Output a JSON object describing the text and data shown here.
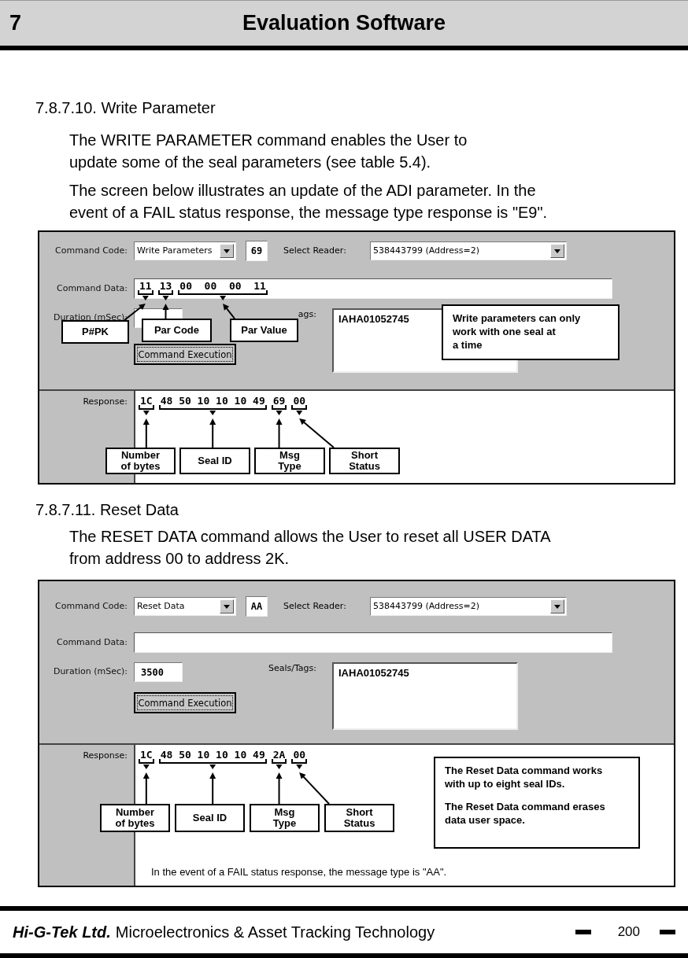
{
  "header": {
    "chapter": "7",
    "title": "Evaluation Software"
  },
  "sections": [
    {
      "heading": "7.8.7.10. Write Parameter",
      "paragraphs": [
        "The WRITE PARAMETER command enables the User to\nupdate some of the seal parameters (see table 5.4).",
        "The screen below illustrates an update of the ADI parameter. In the\nevent of a FAIL status response, the message type response is \"E9\"."
      ],
      "screen": {
        "command_code_label": "Command Code:",
        "command_code": "Write Parameters",
        "code": "69",
        "select_reader_label": "Select Reader:",
        "reader": "538443799 (Address=2)",
        "command_data_label": "Command Data:",
        "command_data": [
          "11",
          "13",
          "00  00  00  11"
        ],
        "duration_label": "Duration (mSec):",
        "seals_label": "ags:",
        "seals": [
          "IAHA01052745"
        ],
        "execute_button": "Command Execution",
        "response_label": "Response:",
        "response": [
          "1C",
          "48 50 10 10 10 49",
          "69",
          "00"
        ],
        "data_callouts": [
          "P#PK",
          "Par Code",
          "Par Value"
        ],
        "response_callouts": [
          "Number\nof bytes",
          "Seal ID",
          "Msg\nType",
          "Short\nStatus"
        ],
        "notes": [
          {
            "paragraphs": [
              "Write parameters can only\nwork with one seal at\na time"
            ]
          }
        ]
      }
    },
    {
      "heading": "7.8.7.11. Reset Data",
      "paragraphs": [
        "The RESET DATA command allows the User to reset all USER DATA\nfrom address 00 to address 2K."
      ],
      "screen": {
        "command_code_label": "Command Code:",
        "command_code": "Reset Data",
        "code": "AA",
        "select_reader_label": "Select Reader:",
        "reader": "538443799 (Address=2)",
        "command_data_label": "Command Data:",
        "duration_label": "Duration (mSec):",
        "duration": "3500",
        "seals_label": "Seals/Tags:",
        "seals": [
          "IAHA01052745"
        ],
        "execute_button": "Command Execution",
        "response_label": "Response:",
        "response": [
          "1C",
          "48 50 10 10 10 49",
          "2A",
          "00"
        ],
        "response_callouts": [
          "Number\nof bytes",
          "Seal ID",
          "Msg\nType",
          "Short\nStatus"
        ],
        "notes": [
          {
            "paragraphs": [
              "The Reset Data command works\nwith up to eight seal IDs.",
              "The Reset Data command erases\ndata user space."
            ]
          }
        ],
        "footnote": "In the event of a FAIL status response, the message type is \"AA\"."
      }
    }
  ],
  "footer": {
    "company": "Hi-G-Tek Ltd.",
    "tagline": "Microelectronics & Asset Tracking Technology",
    "page": "200"
  }
}
